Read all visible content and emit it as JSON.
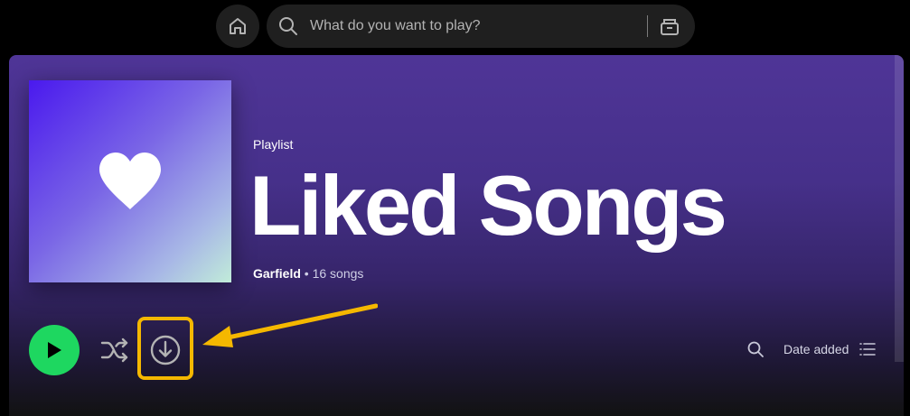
{
  "search": {
    "placeholder": "What do you want to play?",
    "search_icon": "search-icon",
    "browse_icon": "browse-icon"
  },
  "nav": {
    "home_icon": "home-icon"
  },
  "playlist": {
    "kicker": "Playlist",
    "title": "Liked Songs",
    "owner": "Garfield",
    "separator": "•",
    "song_count": "16 songs",
    "cover_icon": "heart-icon"
  },
  "actions": {
    "play_icon": "play-icon",
    "shuffle_icon": "shuffle-icon",
    "download_icon": "download-icon",
    "search_icon": "search-icon",
    "sort_label": "Date added",
    "view_icon": "list-view-icon"
  },
  "annotation": {
    "highlight_color": "#f5b800",
    "accent_green": "#1ed760"
  }
}
